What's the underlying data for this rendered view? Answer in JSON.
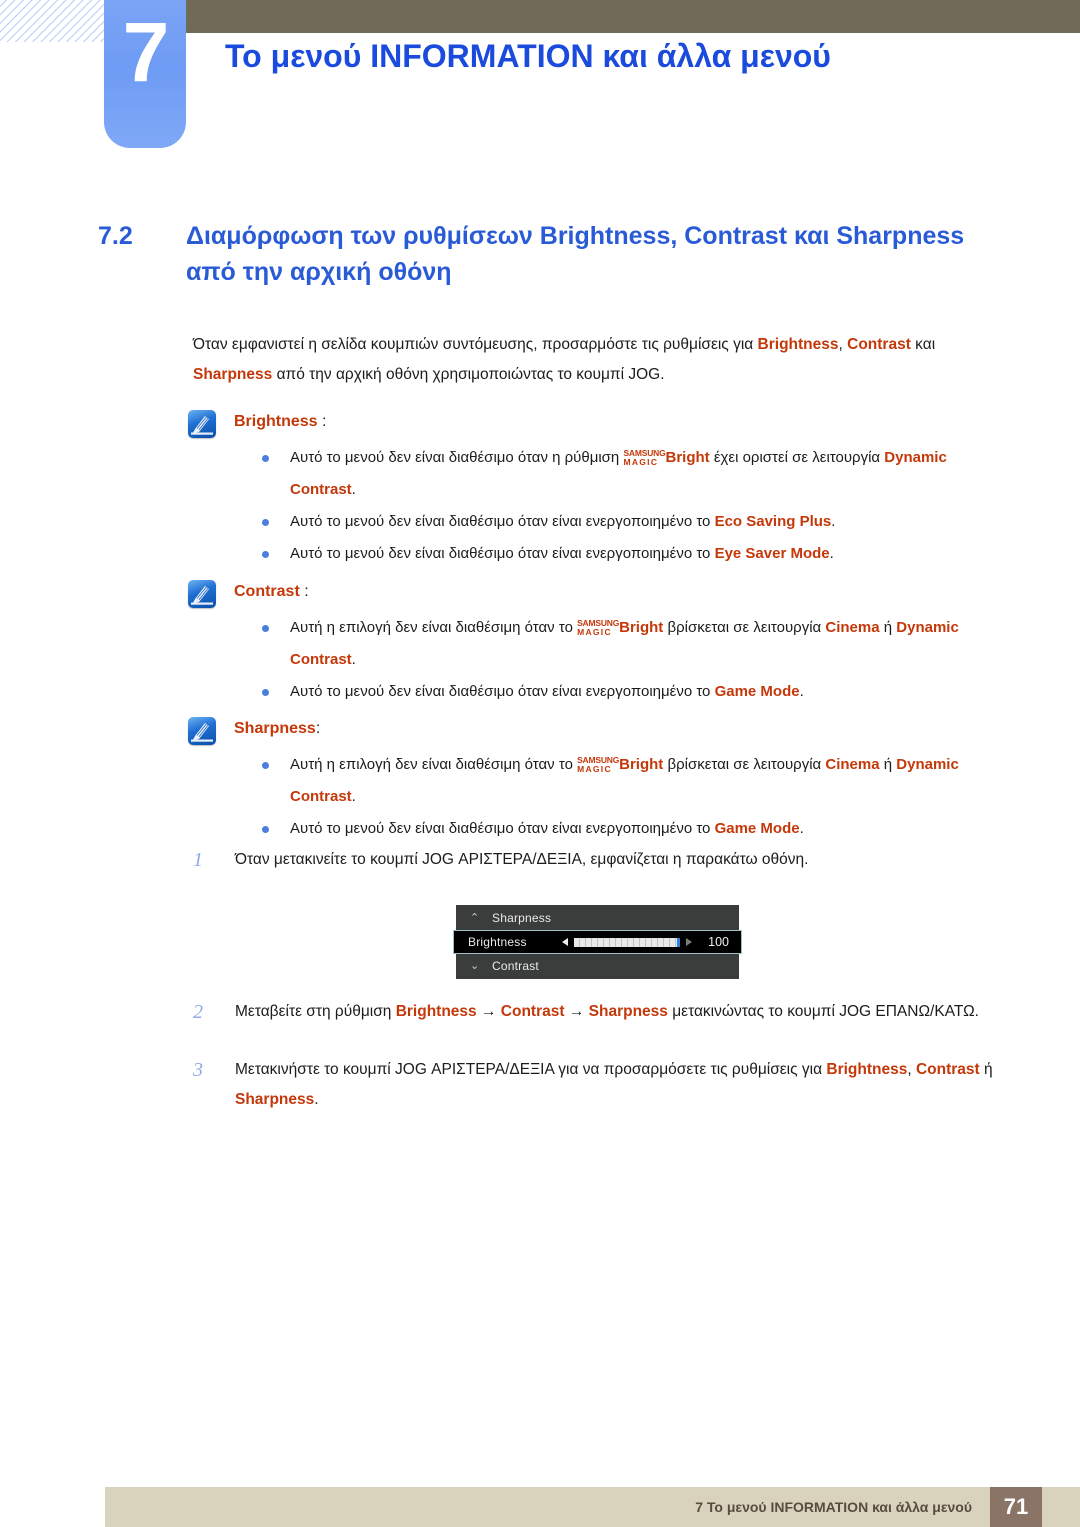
{
  "header": {
    "chapter_number": "7",
    "chapter_title": "Το μενού INFORMATION και άλλα μενού"
  },
  "section": {
    "number": "7.2",
    "title": "Διαμόρφωση των ρυθμίσεων Brightness, Contrast και Sharpness από την αρχική οθόνη"
  },
  "intro": {
    "part1": "Όταν εμφανιστεί η σελίδα κουμπιών συντόμευσης, προσαρμόστε τις ρυθμίσεις για ",
    "hl1": "Brightness",
    "part2": ", ",
    "hl2": "Contrast",
    "part3": " και ",
    "hl3": "Sharpness",
    "part4": " από την αρχική οθόνη χρησιμοποιώντας το κουμπί JOG."
  },
  "notes": [
    {
      "title": "Brightness",
      "colon": " :",
      "bullets": [
        {
          "pre": "Αυτό το μενού δεν είναι διαθέσιμο όταν η ρύθμιση ",
          "magic_top": "SAMSUNG",
          "magic_bottom": "MAGIC",
          "magic_word": "Bright",
          "mid": " έχει οριστεί σε λειτουργία ",
          "hl": "Dynamic Contrast",
          "post": "."
        },
        {
          "pre": "Αυτό το μενού δεν είναι διαθέσιμο όταν είναι ενεργοποιημένο το ",
          "hl": "Eco Saving Plus",
          "post": "."
        },
        {
          "pre": "Αυτό το μενού δεν είναι διαθέσιμο όταν είναι ενεργοποιημένο το ",
          "hl": "Eye Saver Mode",
          "post": "."
        }
      ]
    },
    {
      "title": "Contrast",
      "colon": " :",
      "bullets": [
        {
          "pre": "Αυτή η επιλογή δεν είναι διαθέσιμη όταν το ",
          "magic_top": "SAMSUNG",
          "magic_bottom": "MAGIC",
          "magic_word": "Bright",
          "mid": " βρίσκεται σε λειτουργία ",
          "hl": "Cinema",
          "mid2": " ή ",
          "hl2": "Dynamic Contrast",
          "post": "."
        },
        {
          "pre": "Αυτό το μενού δεν είναι διαθέσιμο όταν είναι ενεργοποιημένο το ",
          "hl": "Game Mode",
          "post": "."
        }
      ]
    },
    {
      "title": "Sharpness",
      "colon": ":",
      "bullets": [
        {
          "pre": "Αυτή η επιλογή δεν είναι διαθέσιμη όταν το ",
          "magic_top": "SAMSUNG",
          "magic_bottom": "MAGIC",
          "magic_word": "Bright",
          "mid": " βρίσκεται σε λειτουργία ",
          "hl": "Cinema",
          "mid2": " ή ",
          "hl2": "Dynamic Contrast",
          "post": "."
        },
        {
          "pre": "Αυτό το μενού δεν είναι διαθέσιμο όταν είναι ενεργοποιημένο το ",
          "hl": "Game Mode",
          "post": "."
        }
      ]
    }
  ],
  "steps": {
    "step1": {
      "number": "1",
      "text": "Όταν μετακινείτε το κουμπί JOG ΑΡΙΣΤΕΡΑ/ΔΕΞΙΑ, εμφανίζεται η παρακάτω οθόνη."
    },
    "step2": {
      "number": "2",
      "pre": "Μεταβείτε στη ρύθμιση ",
      "hl1": "Brightness",
      "arrow1": " → ",
      "hl2": "Contrast",
      "arrow2": " → ",
      "hl3": "Sharpness",
      "post": " μετακινώντας το κουμπί JOG ΕΠΑΝΩ/ΚΑΤΩ."
    },
    "step3": {
      "number": "3",
      "pre": "Μετακινήστε το κουμπί JOG ΑΡΙΣΤΕΡΑ/ΔΕΞΙΑ για να προσαρμόσετε τις ρυθμίσεις για ",
      "hl1": "Brightness",
      "sep1": ", ",
      "hl2": "Contrast",
      "sep2": " ή ",
      "hl3": "Sharpness",
      "post": "."
    }
  },
  "osd": {
    "row_top_label": "Sharpness",
    "row_top_caret": "⌃",
    "row_active_label": "Brightness",
    "row_active_value": "100",
    "row_bottom_label": "Contrast",
    "row_bottom_caret": "⌄"
  },
  "footer": {
    "text": "7 Το μενού INFORMATION και άλλα μενού",
    "page": "71"
  },
  "colors": {
    "accent_blue": "#2a5bd7",
    "title_blue": "#1a4bdd",
    "highlight_orange": "#c4380a",
    "olive_bar": "#6f6b56",
    "tab_blue": "#7ba4f5",
    "footer_band": "#d9d3bd",
    "footer_page_box": "#8a7466",
    "osd_bg": "#3b3d3c",
    "osd_active_border": "#9fc1c4",
    "osd_handle": "#2f7fe0"
  }
}
